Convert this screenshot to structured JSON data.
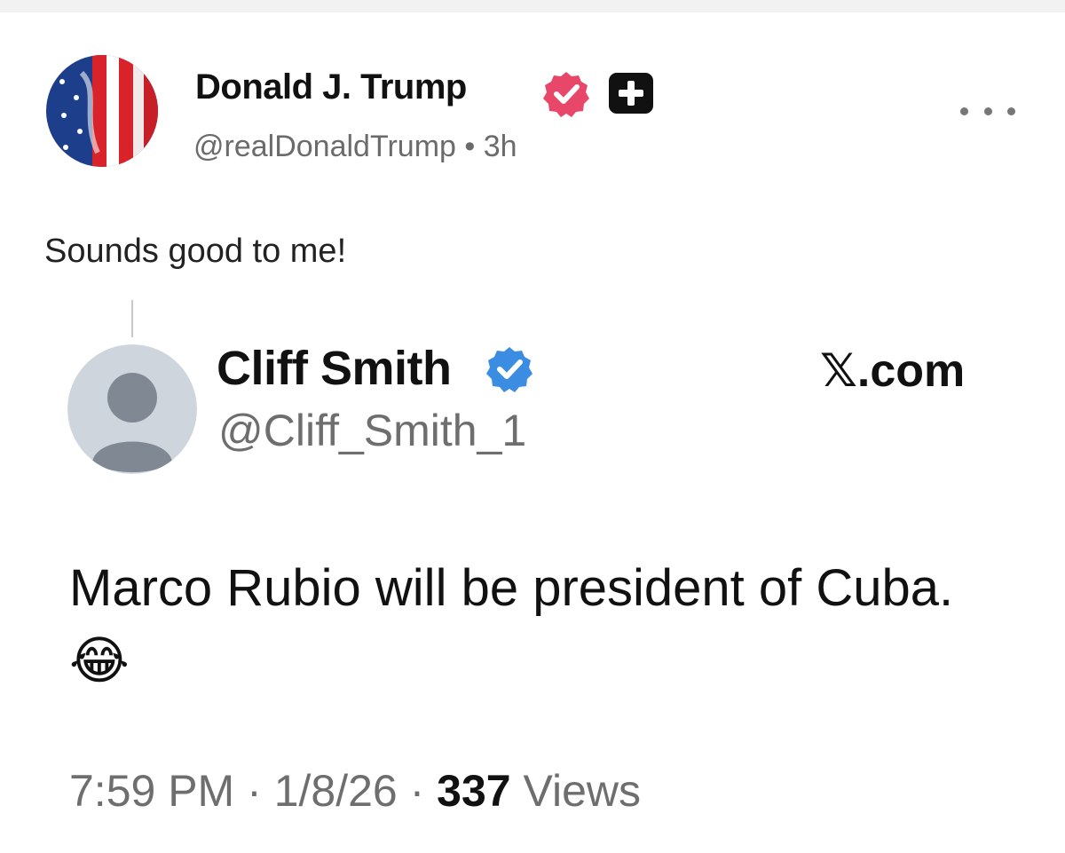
{
  "post": {
    "author_name": "Donald J. Trump",
    "author_handle": "@realDonaldTrump",
    "separator": "•",
    "time_ago": "3h",
    "text": "Sounds good to me!",
    "verified_color": "#e8476a",
    "icons": {
      "avatar": "american-flag-avatar",
      "verified": "verified-badge-icon",
      "plus": "plus-badge-icon",
      "more": "more-options-icon"
    }
  },
  "quoted_post": {
    "author_name": "Cliff Smith",
    "author_handle": "@Cliff_Smith_1",
    "source": "𝕏.com",
    "text": "Marco Rubio will be president of Cuba. 😂",
    "time": "7:59 PM",
    "date": "1/8/26",
    "meta_separator": "·",
    "views_count": "337",
    "views_label": "Views",
    "verified_color": "#3a8de0",
    "icons": {
      "avatar": "default-avatar",
      "verified": "verified-badge-icon"
    }
  }
}
